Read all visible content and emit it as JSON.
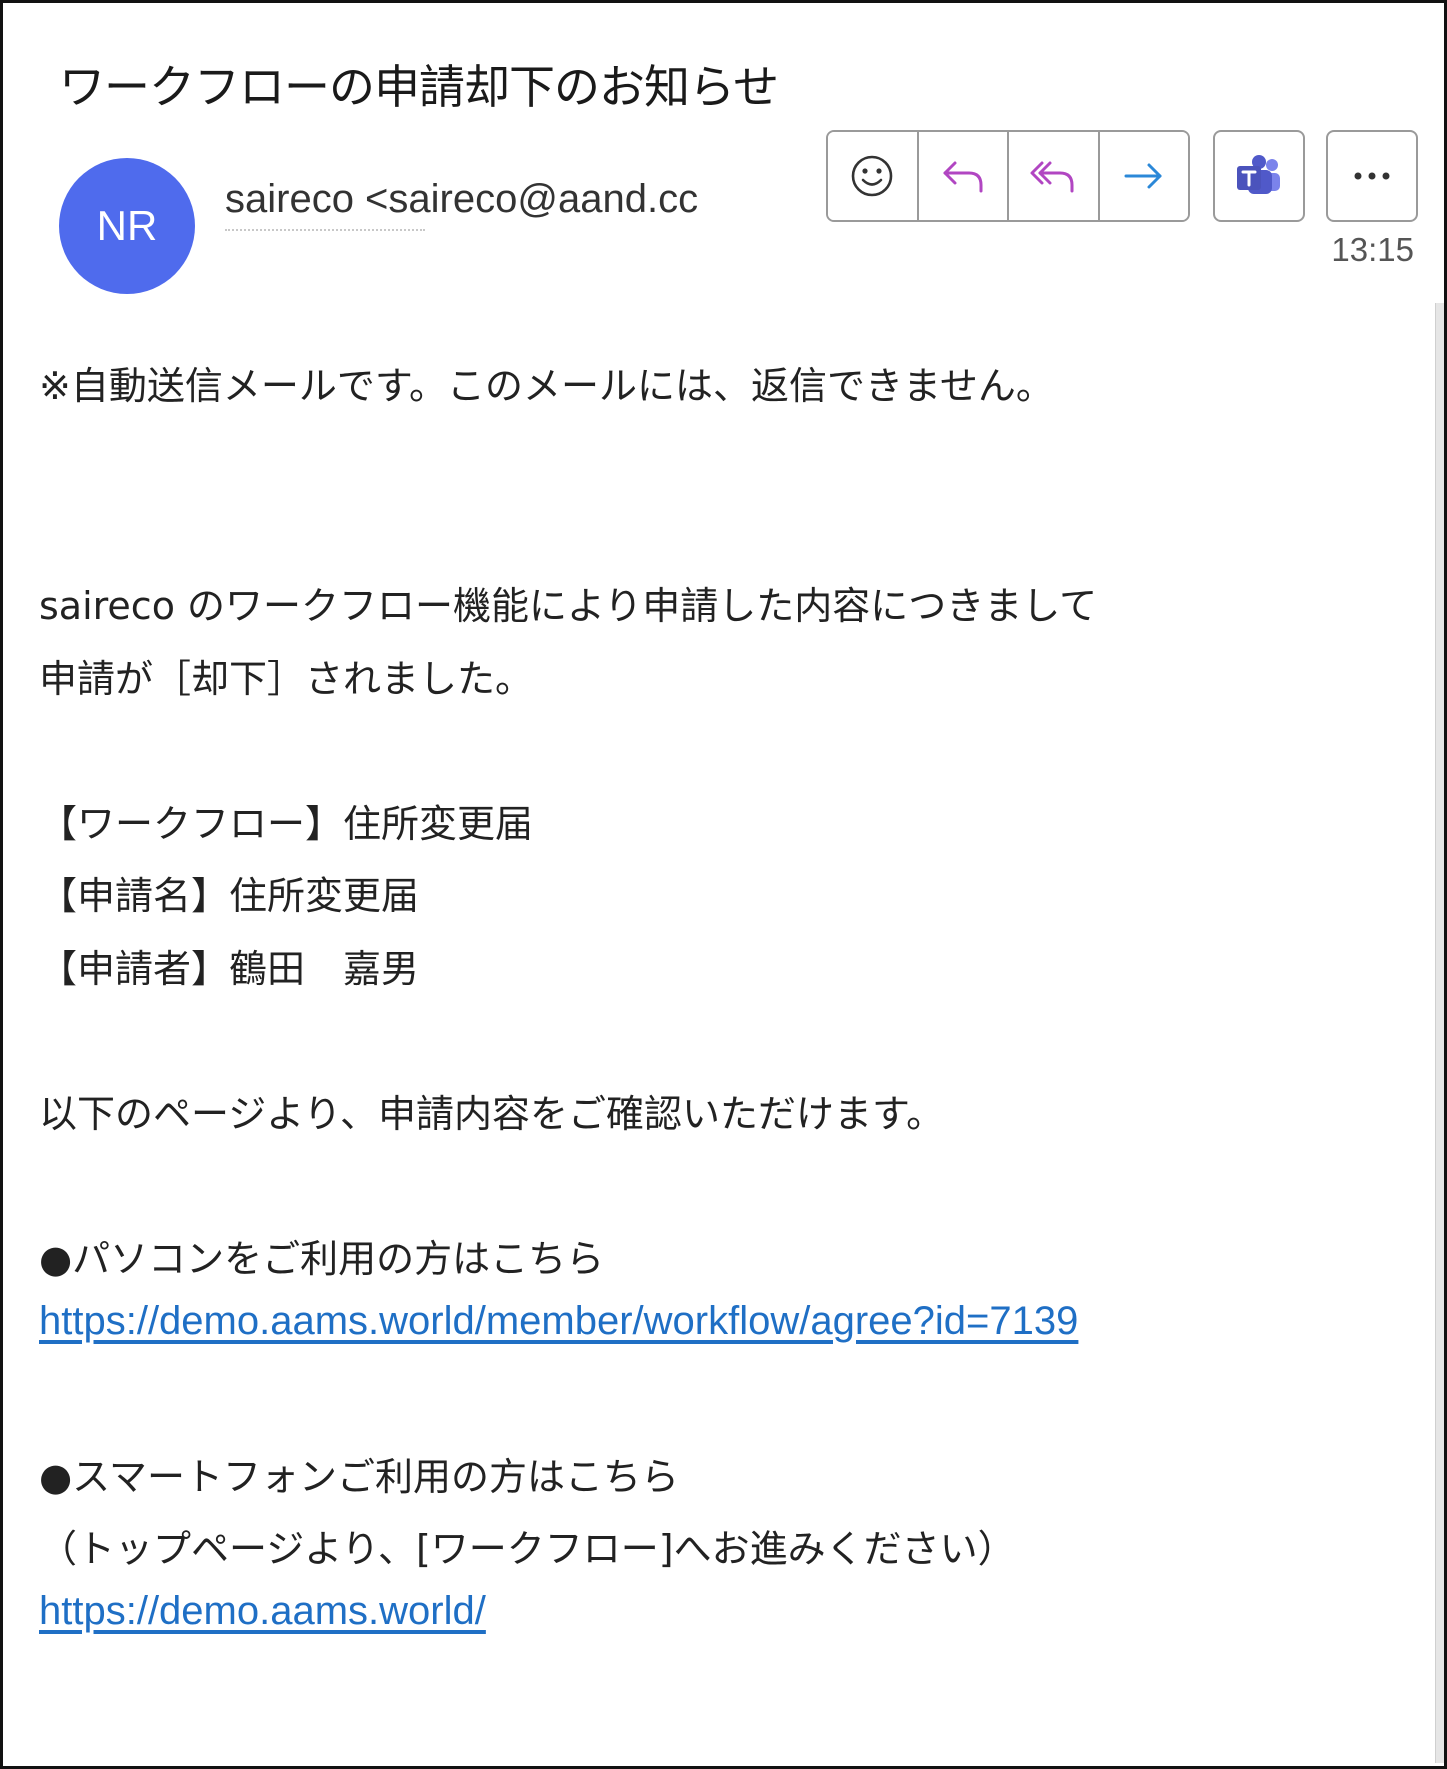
{
  "email": {
    "subject": "ワークフローの申請却下のお知らせ",
    "avatar_initials": "NR",
    "sender": "saireco <saireco@aand.cc",
    "time": "13:15"
  },
  "toolbar": {
    "icons": [
      "smiley-icon",
      "reply-icon",
      "reply-all-icon",
      "forward-icon",
      "teams-icon",
      "more-icon"
    ]
  },
  "colors": {
    "avatar": "#4f6bed",
    "reply_purple": "#b146c2",
    "forward_blue": "#2b88d8",
    "teams_purple": "#5059c9",
    "link": "#1f6fc5"
  },
  "body": {
    "notice": "※自動送信メールです。このメールには、返信できません。",
    "intro_1": "saireco のワークフロー機能により申請した内容につきまして",
    "intro_2": "申請が［却下］されました。",
    "workflow": "【ワークフロー】住所変更届",
    "application_name": "【申請名】住所変更届",
    "applicant": "【申請者】鶴田　嘉男",
    "confirm": "以下のページより、申請内容をご確認いただけます。",
    "pc_heading": "●パソコンをご利用の方はこちら",
    "pc_link": "https://demo.aams.world/member/workflow/agree?id=7139",
    "sp_heading": "●スマートフォンご利用の方はこちら",
    "sp_note": "（トップページより、[ワークフロー]へお進みください）",
    "sp_link": "https://demo.aams.world/"
  }
}
